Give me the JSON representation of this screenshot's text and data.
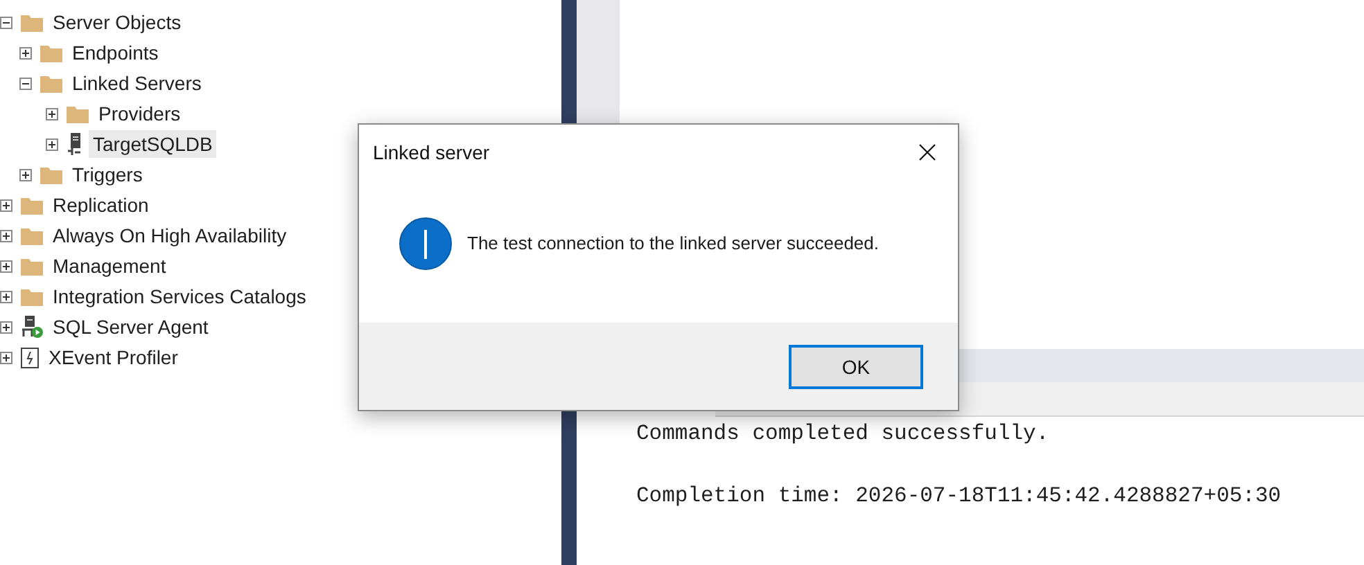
{
  "object_explorer": {
    "items": [
      {
        "label": "Server Objects",
        "kind": "folder",
        "expanded": true,
        "selected": false,
        "children": [
          {
            "label": "Endpoints",
            "kind": "folder",
            "expanded": false,
            "selected": false
          },
          {
            "label": "Linked Servers",
            "kind": "folder",
            "expanded": true,
            "selected": false,
            "children": [
              {
                "label": "Providers",
                "kind": "folder",
                "expanded": false,
                "selected": false
              },
              {
                "label": "TargetSQLDB",
                "kind": "server",
                "expanded": false,
                "selected": true
              }
            ]
          },
          {
            "label": "Triggers",
            "kind": "folder",
            "expanded": false,
            "selected": false
          }
        ]
      },
      {
        "label": "Replication",
        "kind": "folder",
        "expanded": false,
        "selected": false
      },
      {
        "label": "Always On High Availability",
        "kind": "folder",
        "expanded": false,
        "selected": false
      },
      {
        "label": "Management",
        "kind": "folder",
        "expanded": false,
        "selected": false
      },
      {
        "label": "Integration Services Catalogs",
        "kind": "folder",
        "expanded": false,
        "selected": false
      },
      {
        "label": "SQL Server Agent",
        "kind": "agent",
        "expanded": false,
        "selected": false
      },
      {
        "label": "XEvent Profiler",
        "kind": "profiler",
        "expanded": false,
        "selected": false
      }
    ]
  },
  "messages": [
    "Commands completed successfully.",
    "Completion time: 2026-07-18T11:45:42.4288827+05:30"
  ],
  "dialog": {
    "title": "Linked server",
    "message": "The test connection to the linked server succeeded.",
    "buttons": [
      "OK"
    ]
  }
}
